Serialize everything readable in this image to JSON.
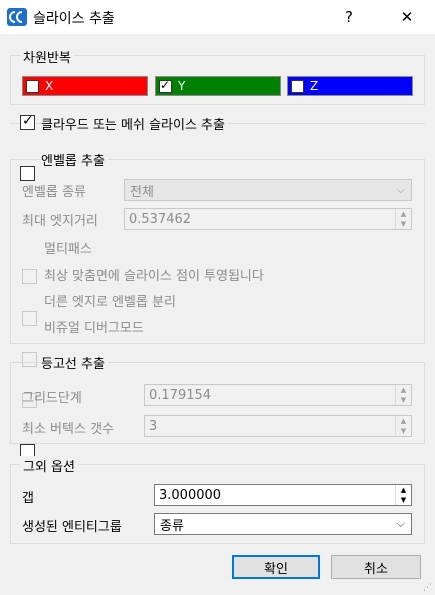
{
  "window": {
    "title": "슬라이스 추출",
    "help": "?",
    "close": "✕"
  },
  "axes_group": {
    "label": "차원반복",
    "axes": [
      {
        "label": "X",
        "color": "#ff0000",
        "checked": false
      },
      {
        "label": "Y",
        "color": "#008000",
        "checked": true
      },
      {
        "label": "Z",
        "color": "#0000ff",
        "checked": false
      }
    ]
  },
  "cloud_mesh": {
    "label": "클라우드 또는 메쉬 슬라이스 추출",
    "checked": true
  },
  "envelope": {
    "label": "엔벨롭 추출",
    "checked": false,
    "type_label": "엔벨롭 종류",
    "type_value": "전체",
    "max_edge_label": "최대 엣지거리",
    "max_edge_value": "0.537462",
    "options": [
      "멀티패스",
      "최상 맞춤면에 슬라이스 점이 투영됩니다",
      "더른 엣지로 엔벨롭 분리",
      "비쥬얼 디버그모드"
    ]
  },
  "contour": {
    "label": "등고선 추출",
    "checked": false,
    "grid_step_label": "그리드단계",
    "grid_step_value": "0.179154",
    "min_vertex_label": "최소 버텍스 갯수",
    "min_vertex_value": "3"
  },
  "other": {
    "label": "그외 옵션",
    "gap_label": "갭",
    "gap_value": "3.000000",
    "entity_group_label": "생성된 엔티티그룹",
    "entity_group_value": "종류"
  },
  "buttons": {
    "ok": "확인",
    "cancel": "취소"
  }
}
